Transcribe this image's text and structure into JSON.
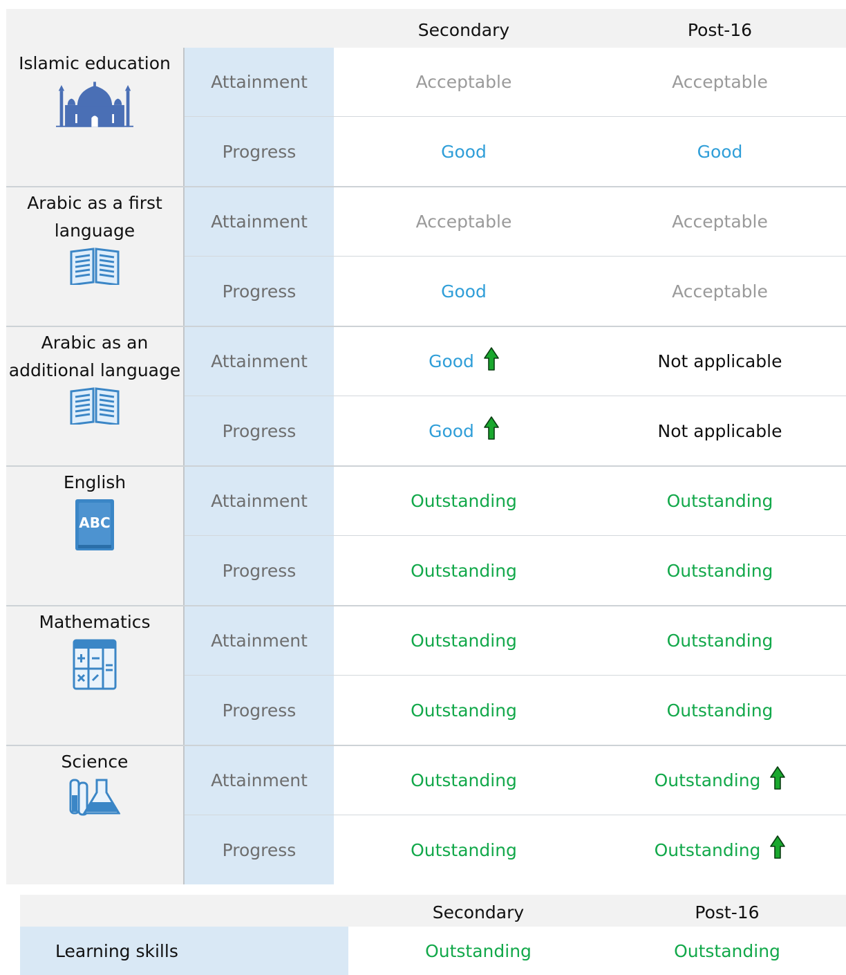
{
  "headers": {
    "col1": "Secondary",
    "col2": "Post-16"
  },
  "colors": {
    "acceptable": "#9a9a9a",
    "good": "#2f9ed8",
    "outstanding": "#12a84a",
    "not_applicable": "#111111",
    "label_bg": "#d9e8f5",
    "arrow": "#1aa82e"
  },
  "subjects": [
    {
      "name": "Islamic education",
      "icon": "mosque-icon",
      "rows": [
        {
          "label": "Attainment",
          "secondary": "Acceptable",
          "secondary_improved": false,
          "post16": "Acceptable",
          "post16_improved": false
        },
        {
          "label": "Progress",
          "secondary": "Good",
          "secondary_improved": false,
          "post16": "Good",
          "post16_improved": false
        }
      ]
    },
    {
      "name": "Arabic as a first language",
      "icon": "open-book-icon",
      "rows": [
        {
          "label": "Attainment",
          "secondary": "Acceptable",
          "secondary_improved": false,
          "post16": "Acceptable",
          "post16_improved": false
        },
        {
          "label": "Progress",
          "secondary": "Good",
          "secondary_improved": false,
          "post16": "Acceptable",
          "post16_improved": false
        }
      ]
    },
    {
      "name": "Arabic as an additional language",
      "icon": "open-book-icon",
      "rows": [
        {
          "label": "Attainment",
          "secondary": "Good",
          "secondary_improved": true,
          "post16": "Not applicable",
          "post16_improved": false
        },
        {
          "label": "Progress",
          "secondary": "Good",
          "secondary_improved": true,
          "post16": "Not applicable",
          "post16_improved": false
        }
      ]
    },
    {
      "name": "English",
      "icon": "abc-book-icon",
      "rows": [
        {
          "label": "Attainment",
          "secondary": "Outstanding",
          "secondary_improved": false,
          "post16": "Outstanding",
          "post16_improved": false
        },
        {
          "label": "Progress",
          "secondary": "Outstanding",
          "secondary_improved": false,
          "post16": "Outstanding",
          "post16_improved": false
        }
      ]
    },
    {
      "name": "Mathematics",
      "icon": "calculator-icon",
      "rows": [
        {
          "label": "Attainment",
          "secondary": "Outstanding",
          "secondary_improved": false,
          "post16": "Outstanding",
          "post16_improved": false
        },
        {
          "label": "Progress",
          "secondary": "Outstanding",
          "secondary_improved": false,
          "post16": "Outstanding",
          "post16_improved": false
        }
      ]
    },
    {
      "name": "Science",
      "icon": "flask-icon",
      "rows": [
        {
          "label": "Attainment",
          "secondary": "Outstanding",
          "secondary_improved": false,
          "post16": "Outstanding",
          "post16_improved": true
        },
        {
          "label": "Progress",
          "secondary": "Outstanding",
          "secondary_improved": false,
          "post16": "Outstanding",
          "post16_improved": true
        }
      ]
    }
  ],
  "skills": {
    "headers": {
      "col1": "Secondary",
      "col2": "Post-16"
    },
    "row": {
      "label": "Learning skills",
      "secondary": "Outstanding",
      "post16": "Outstanding"
    }
  }
}
